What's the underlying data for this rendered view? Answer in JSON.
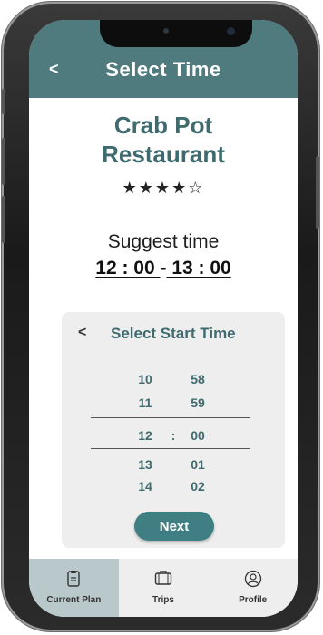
{
  "header": {
    "back_label": "<",
    "title": "Select  Time"
  },
  "restaurant": {
    "name_line1": "Crab Pot",
    "name_line2": "Restaurant",
    "rating_stars": "★★★★☆",
    "rating": 4,
    "rating_max": 5
  },
  "suggest": {
    "label": "Suggest time",
    "start": "12 : 00 ",
    "separator": "-",
    "end": " 13 : 00"
  },
  "picker": {
    "back_label": "<",
    "title": "Select Start Time",
    "rows": [
      {
        "hour": "10",
        "minute": "58"
      },
      {
        "hour": "11",
        "minute": "59"
      },
      {
        "hour": "12",
        "sep": ":",
        "minute": "00"
      },
      {
        "hour": "13",
        "minute": "01"
      },
      {
        "hour": "14",
        "minute": "02"
      }
    ],
    "next_label": "Next"
  },
  "nav": {
    "items": [
      {
        "label": "Current Plan",
        "icon": "clipboard-icon",
        "active": true
      },
      {
        "label": "Trips",
        "icon": "suitcase-icon",
        "active": false
      },
      {
        "label": "Profile",
        "icon": "user-icon",
        "active": false
      }
    ]
  },
  "colors": {
    "header_bg": "#4f7b7f",
    "accent": "#3f6a6e",
    "button": "#3f7f83",
    "nav_active": "#b9c8ca"
  }
}
